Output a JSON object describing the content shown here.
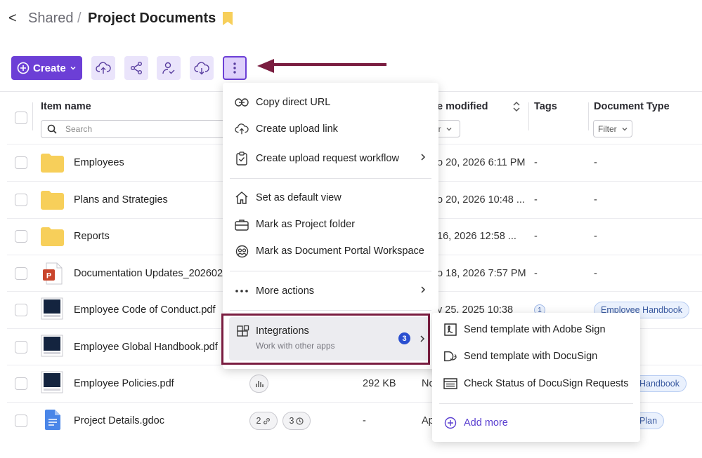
{
  "breadcrumb": {
    "back": "<",
    "parent": "Shared",
    "separator": "/",
    "current": "Project Documents"
  },
  "toolbar": {
    "create_label": "Create"
  },
  "table": {
    "headers": {
      "item_name": "Item name",
      "last_modified": "e modified",
      "tags": "Tags",
      "document_type": "Document Type"
    },
    "search_placeholder": "Search",
    "filter_label_1": "er",
    "filter_label_2": "Filter",
    "rows": [
      {
        "name": "Employees",
        "date": "o 20, 2026 6:11 PM",
        "tags": "-",
        "doctype": "-"
      },
      {
        "name": "Plans and Strategies",
        "date": "o 20, 2026 10:48 ...",
        "tags": "-",
        "doctype": "-"
      },
      {
        "name": "Reports",
        "date": "16, 2026 12:58 ...",
        "tags": "-",
        "doctype": "-"
      },
      {
        "name": "Documentation Updates_202602",
        "date": "o 18, 2026 7:57 PM",
        "tags": "-",
        "doctype": "-"
      },
      {
        "name": "Employee Code of Conduct.pdf",
        "date": "y 25, 2025 10:38",
        "tag_count": "1",
        "doctype": "Employee Handbook"
      },
      {
        "name": "Employee Global Handbook.pdf"
      },
      {
        "name": "Employee Policies.pdf",
        "size": "292 KB",
        "modified_cut": "No",
        "doctype": "Handbook"
      },
      {
        "name": "Project Details.gdoc",
        "pill_1": "2",
        "pill_2": "3",
        "size": "-",
        "modified_cut": "Ap",
        "doctype": "Plan"
      }
    ]
  },
  "menu": {
    "items": [
      {
        "label": "Copy direct URL",
        "icon": "link-icon"
      },
      {
        "label": "Create upload link",
        "icon": "cloud-upload-icon"
      },
      {
        "label": "Create upload request workflow",
        "icon": "clipboard-check-icon"
      },
      {
        "label": "Set as default view",
        "icon": "home-icon"
      },
      {
        "label": "Mark as Project folder",
        "icon": "briefcase-icon"
      },
      {
        "label": "Mark as Document Portal Workspace",
        "icon": "portal-icon"
      },
      {
        "label": "More actions",
        "icon": "ellipsis-icon"
      }
    ],
    "integrations": {
      "title": "Integrations",
      "subtitle": "Work with other apps",
      "badge": "3"
    }
  },
  "submenu": {
    "items": [
      {
        "label": "Send template with Adobe Sign",
        "icon": "adobe-sign-icon"
      },
      {
        "label": "Send template with DocuSign",
        "icon": "docusign-icon"
      },
      {
        "label": "Check Status of DocuSign Requests",
        "icon": "status-list-icon"
      }
    ],
    "add_more": "Add more"
  },
  "colors": {
    "accent": "#6c3fd6",
    "highlight": "#7a1d40",
    "badge": "#2a4fd0",
    "folder": "#f7cf5a"
  }
}
